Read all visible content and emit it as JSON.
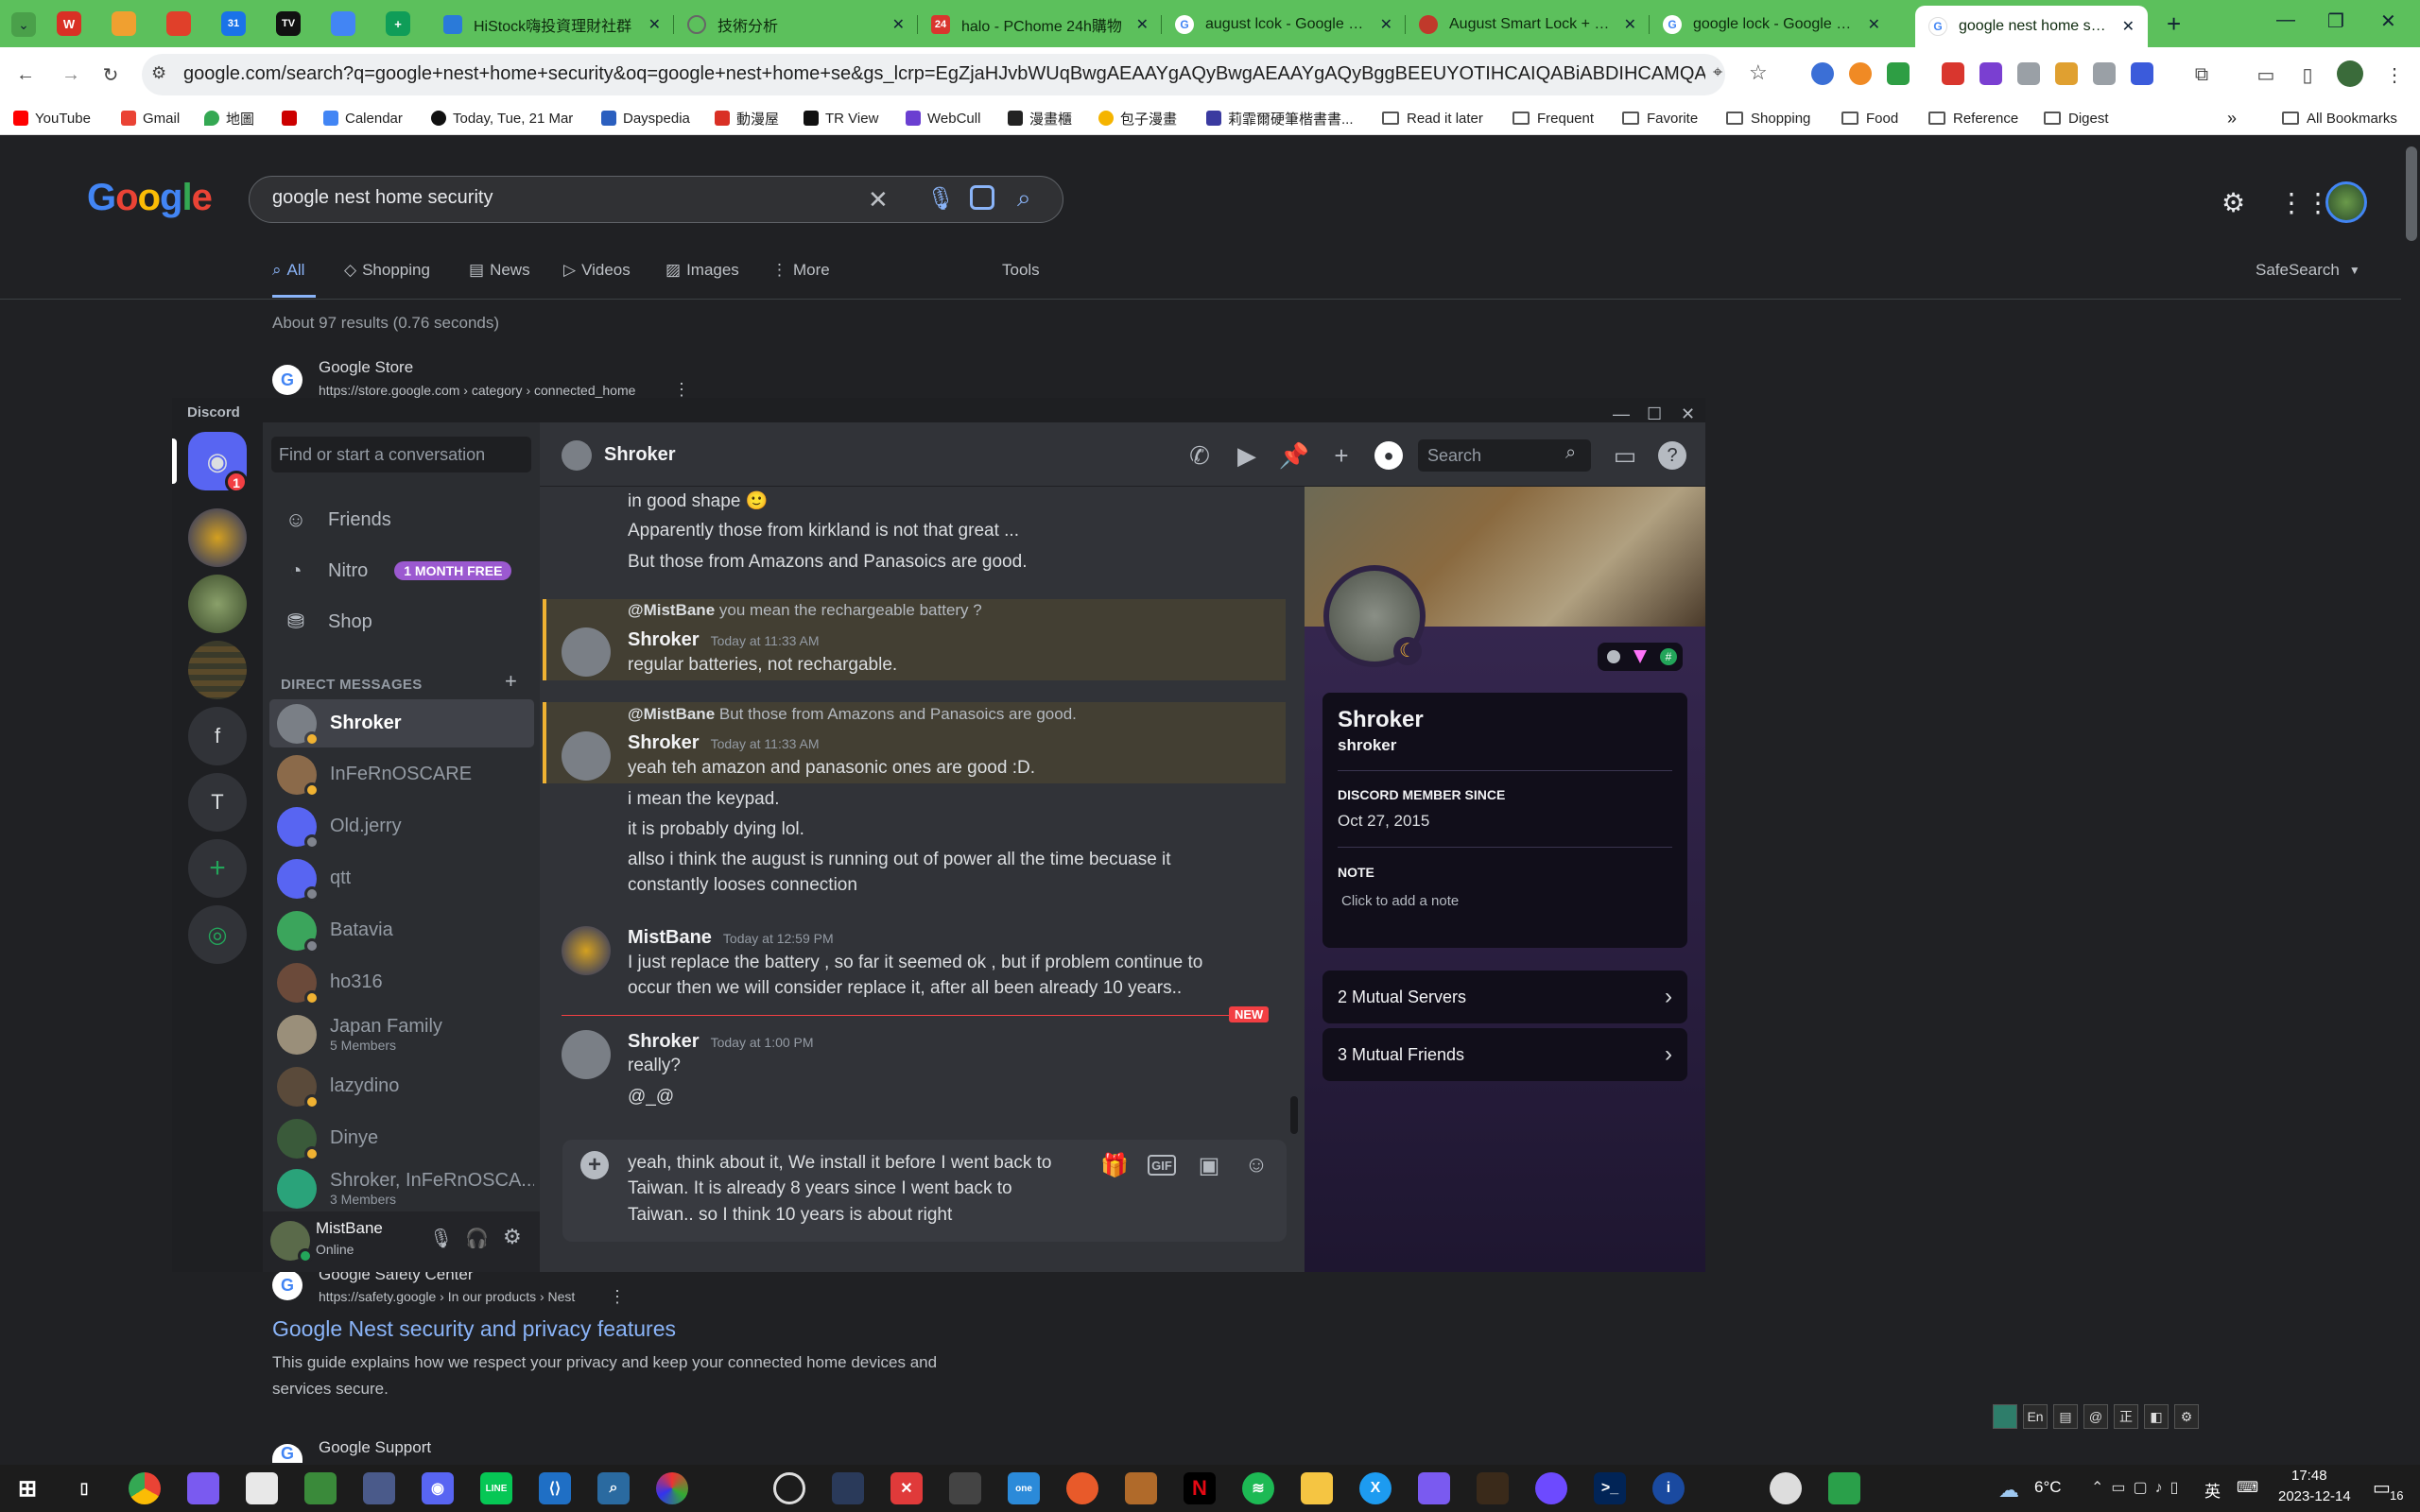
{
  "browser": {
    "tabs": [
      {
        "title": "HiStock嗨投資理財社群",
        "icon_color": "#2a7ad9"
      },
      {
        "title": "技術分析",
        "icon_color": "#8a8a8a"
      },
      {
        "title": "halo - PChome 24h購物",
        "icon_color": "#d9362e"
      },
      {
        "title": "august lcok - Google Sear",
        "icon_color": "#4285f4"
      },
      {
        "title": "August Smart Lock + Con",
        "icon_color": "#c0392b"
      },
      {
        "title": "google lock - Google Sear",
        "icon_color": "#4285f4"
      },
      {
        "title": "google nest home securit",
        "icon_color": "#4285f4"
      }
    ],
    "pinned_tabs": [
      "W",
      "",
      "",
      "31",
      "TV",
      "",
      "+"
    ],
    "new_tab": "+",
    "url": "google.com/search?q=google+nest+home+security&oq=google+nest+home+se&gs_lcrp=EgZjaHJvbWUqBwgAEAAYgAQyBwgAEAAYgAQyBggBEEUYOTIHCAIQABiABDIHCAMQABiABDIHCAQQABiABDIGCA...",
    "bookmarks": [
      {
        "label": "YouTube",
        "color": "#ff0000"
      },
      {
        "label": "Gmail",
        "color": "#ea4335"
      },
      {
        "label": "地圖",
        "color": "#34a853"
      },
      {
        "label": "",
        "color": "#cc0000"
      },
      {
        "label": "Calendar",
        "color": "#4285f4"
      },
      {
        "label": "Today, Tue, 21 Mar",
        "color": "#111111"
      },
      {
        "label": "Dayspedia",
        "color": "#2b5fbf"
      },
      {
        "label": "動漫屋",
        "color": "#d93025"
      },
      {
        "label": "TR View",
        "color": "#111111"
      },
      {
        "label": "WebCull",
        "color": "#6a3fd1"
      },
      {
        "label": "漫畫櫃",
        "color": "#222222"
      },
      {
        "label": "包子漫畫",
        "color": "#f5b400"
      },
      {
        "label": "莉霏爾硬筆楷書書...",
        "color": "#3a3aa0"
      }
    ],
    "bookmark_folders": [
      "Read it later",
      "Frequent",
      "Favorite",
      "Shopping",
      "Food",
      "Reference",
      "Digest"
    ],
    "all_bookmarks": "All Bookmarks"
  },
  "google": {
    "logo": "Google",
    "query": "google nest home security",
    "tabs": [
      "All",
      "Shopping",
      "News",
      "Videos",
      "Images",
      "More"
    ],
    "tools": "Tools",
    "safesearch": "SafeSearch",
    "stats": "About 97 results (0.76 seconds)",
    "result1": {
      "source": "Google Store",
      "url": "https://store.google.com › category › connected_home"
    },
    "result2": {
      "source": "Google Safety Center",
      "url": "https://safety.google › In our products › Nest",
      "title": "Google Nest security and privacy features",
      "snippet1": "This guide explains how we respect your privacy and keep your connected home devices and",
      "snippet2": "services secure."
    },
    "result3": {
      "source": "Google Support"
    }
  },
  "discord": {
    "app_title": "Discord",
    "unread_badge": "1",
    "server_letters": [
      "f",
      "T"
    ],
    "dm_search_placeholder": "Find or start a conversation",
    "nav": [
      {
        "label": "Friends"
      },
      {
        "label": "Nitro",
        "badge": "1 MONTH FREE"
      },
      {
        "label": "Shop"
      }
    ],
    "dm_header": "DIRECT MESSAGES",
    "dms": [
      {
        "name": "Shroker",
        "av": "#7a7f86",
        "status": "#f0b232"
      },
      {
        "name": "InFeRnOSCARE",
        "av": "#8b6a4a",
        "status": "#f0b232"
      },
      {
        "name": "Old.jerry",
        "av": "#5865f2",
        "status": "#80848e"
      },
      {
        "name": "qtt",
        "av": "#5865f2",
        "status": "#80848e"
      },
      {
        "name": "Batavia",
        "av": "#3ba55c",
        "status": "#80848e"
      },
      {
        "name": "ho316",
        "av": "#6b4a3a",
        "status": "#f0b232"
      },
      {
        "name": "Japan Family",
        "sub": "5 Members",
        "av": "#9a8f7a",
        "status": ""
      },
      {
        "name": "lazydino",
        "av": "#5a4a3a",
        "status": "#f0b232"
      },
      {
        "name": "Dinye",
        "av": "#3a5a3a",
        "status": "#f0b232"
      },
      {
        "name": "Shroker, InFeRnOSCA...",
        "sub": "3 Members",
        "av": "#2aa37a",
        "status": ""
      }
    ],
    "me": {
      "name": "MistBane",
      "status": "Online"
    },
    "channel": {
      "name": "Shroker",
      "search_placeholder": "Search"
    },
    "messages": {
      "m0a": "in good shape 🙂",
      "m0b": "Apparently those from kirkland is not that great ...",
      "m0c": "But those from Amazons and Panasoics are good.",
      "r1_user": "@MistBane",
      "r1_text": "you mean the rechargeable battery ?",
      "g1_user": "Shroker",
      "g1_time": "Today at 11:33 AM",
      "g1_text": "regular batteries, not rechargable.",
      "r2_user": "@MistBane",
      "r2_text": "But those from Amazons and Panasoics are good.",
      "g2_user": "Shroker",
      "g2_time": "Today at 11:33 AM",
      "g2_text": "yeah teh amazon and panasonic ones are good :D.",
      "g2_b": "i mean the keypad.",
      "g2_c": "it is probably dying lol.",
      "g2_d1": "allso i think the august is running out of power all the time becuase it",
      "g2_d2": "constantly looses connection",
      "g3_user": "MistBane",
      "g3_time": "Today at 12:59 PM",
      "g3_text1": "I just replace the battery , so far it seemed ok , but if problem continue to",
      "g3_text2": "occur then we will consider replace it, after all been already 10 years..",
      "new_label": "NEW",
      "g4_user": "Shroker",
      "g4_time": "Today at 1:00 PM",
      "g4_text": "really?",
      "g4_b": "@_@"
    },
    "composer": {
      "line1": "yeah, think about it, We install it before I went back to",
      "line2": "Taiwan. It is already 8 years since I went back to",
      "line3": "Taiwan.. so I think 10 years is about right",
      "gif": "GIF"
    },
    "profile": {
      "display_name": "Shroker",
      "username": "shroker",
      "member_since_label": "DISCORD MEMBER SINCE",
      "member_since": "Oct 27, 2015",
      "note_label": "NOTE",
      "note_placeholder": "Click to add a note",
      "mutual_servers": "2 Mutual Servers",
      "mutual_friends": "3 Mutual Friends"
    }
  },
  "taskbar": {
    "weather": "6°C",
    "ime": "英",
    "time": "17:48",
    "date": "2023-12-14",
    "notif": "16",
    "ime_bar": [
      "",
      "En",
      "",
      "@",
      "",
      "",
      ""
    ]
  }
}
